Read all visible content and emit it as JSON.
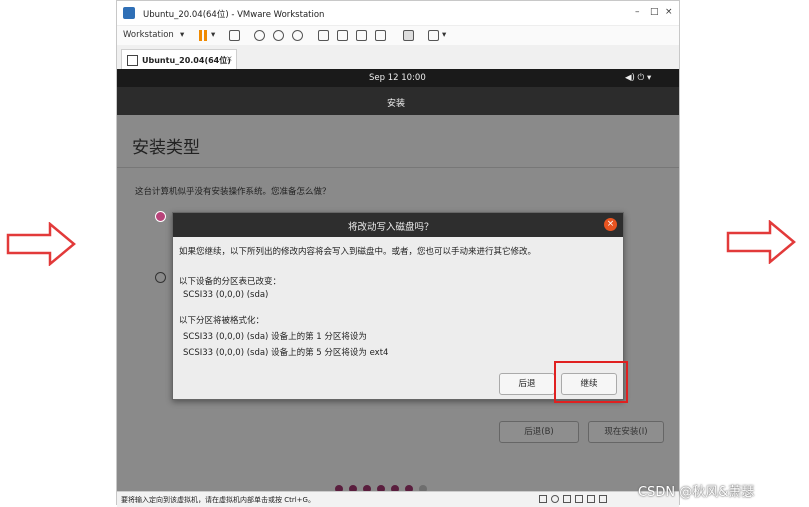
{
  "window": {
    "title": "Ubuntu_20.04(64位) - VMware Workstation",
    "controls": {
      "minimize": "–",
      "maximize": "□",
      "close": "×"
    }
  },
  "toolbar": {
    "workstation_label": "Workstation"
  },
  "tab": {
    "label": "Ubuntu_20.04(64位)",
    "close": "×"
  },
  "ubuntu_topbar": {
    "clock": "Sep 12  10:00",
    "tray": "◀) ⏻ ▾"
  },
  "installer": {
    "header_title": "安装",
    "heading": "安装类型",
    "question": "这台计算机似乎没有安装操作系统。您准备怎么做？",
    "back_button": "后退(B)",
    "install_now_button": "现在安装(I)"
  },
  "dialog": {
    "title": "将改动写入磁盘吗？",
    "close": "×",
    "intro": "如果您继续，以下所列出的修改内容将会写入到磁盘中。或者，您也可以手动来进行其它修改。",
    "partition_changed_heading": "以下设备的分区表已改变：",
    "partition_changed_item": "SCSI33 (0,0,0) (sda)",
    "format_heading": "以下分区将被格式化：",
    "format_items": [
      "SCSI33 (0,0,0) (sda) 设备上的第 1 分区将设为",
      "SCSI33 (0,0,0) (sda) 设备上的第 5 分区将设为 ext4"
    ],
    "back_button": "后退",
    "continue_button": "继续"
  },
  "statusbar": {
    "text": "要将输入定向到该虚拟机，请在虚拟机内部单击或按 Ctrl+G。"
  },
  "watermark": "CSDN @秋风&萧瑟",
  "colors": {
    "accent": "#e95420",
    "radio_selected": "#b8447a",
    "highlight": "#e02020"
  }
}
